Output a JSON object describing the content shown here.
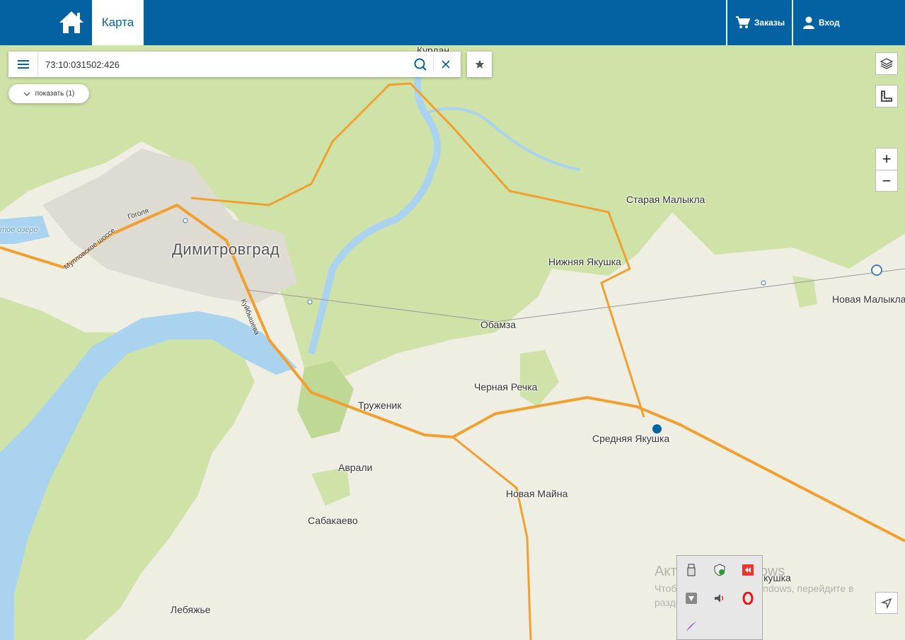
{
  "header": {
    "home_icon": "home-icon",
    "tab_map": "Карта",
    "orders_label": "Заказы",
    "login_label": "Вход",
    "brand_color": "#0562a2"
  },
  "search": {
    "value": "73:10:031502:426",
    "menu_icon": "hamburger-icon",
    "search_icon": "search-icon",
    "clear_icon": "close-icon",
    "favorite_icon": "star-icon"
  },
  "show_button": {
    "label": "показать (1)"
  },
  "controls": {
    "layers_icon": "layers-icon",
    "ruler_icon": "ruler-icon",
    "zoom_in": "+",
    "zoom_out": "−",
    "locate_icon": "navigation-arrow-icon"
  },
  "map": {
    "places": {
      "kurdan": "Курдан",
      "dimitrovgrad": "Димитровград",
      "staraya_malykla": "Старая Малыкла",
      "nizhnyaya_yakushka": "Нижняя Якушка",
      "novaya_malykla": "Новая Малыкла",
      "obamza": "Обамза",
      "chernaya_rechka": "Черная Речка",
      "truzhenik": "Труженик",
      "srednyaya_yakushka": "Средняя Якушка",
      "avrali": "Аврали",
      "novaya_mayna": "Новая Майна",
      "sabakaevo": "Сабакаево",
      "lebyazhye": "Лебяжье",
      "yakushka_partial": "Якушка",
      "lake_partial": "тое озеро"
    },
    "streets": {
      "mullovskoe": "Мулловское шоссе",
      "gogolya": "Гоголя",
      "kuybysheva": "Куйбышева"
    },
    "colors": {
      "land": "#efeee3",
      "forest": "#cfe2a8",
      "water": "#a9d3ef",
      "road_major": "#f0a030",
      "urban": "#dedcd2",
      "marker": "#0562a2"
    }
  },
  "watermark": {
    "title": "Активация Windows",
    "subtitle": "Чтобы активировать Windows, перейдите в раздел \"Параметры\"."
  },
  "tray": {
    "icons": [
      "usb-drive-icon",
      "shield-icon",
      "media-icon",
      "network-icon",
      "speaker-icon",
      "opera-icon",
      "feather-icon"
    ]
  }
}
